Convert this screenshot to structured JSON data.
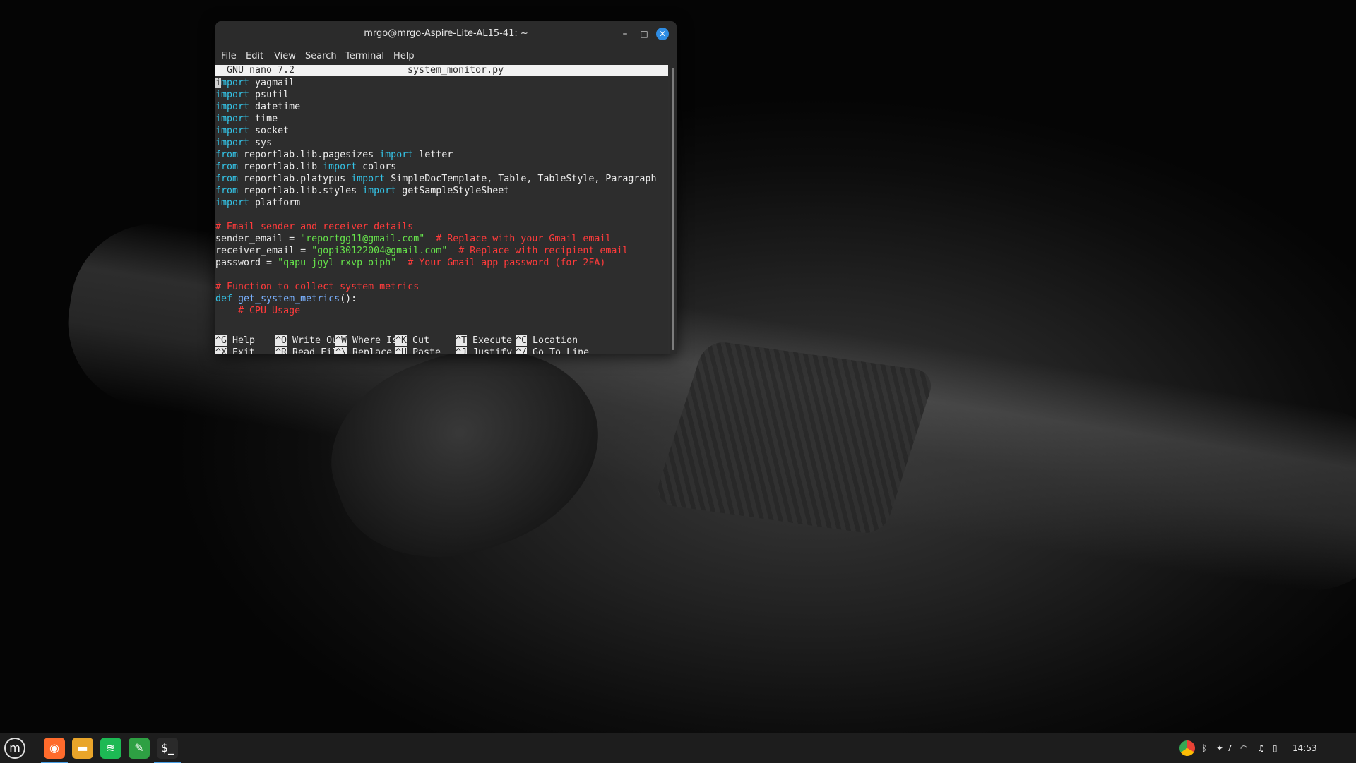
{
  "window": {
    "title": "mrgo@mrgo-Aspire-Lite-AL15-41: ~",
    "controls": {
      "minimize": "–",
      "maximize": "□",
      "close": "✕"
    }
  },
  "menu": [
    "File",
    "Edit",
    "View",
    "Search",
    "Terminal",
    "Help"
  ],
  "nano": {
    "version": "GNU nano 7.2",
    "filename": "system_monitor.py"
  },
  "code_lines": [
    [
      {
        "t": "import",
        "c": "kw"
      },
      {
        "t": " yagmail",
        "c": ""
      }
    ],
    [
      {
        "t": "import",
        "c": "kw"
      },
      {
        "t": " psutil",
        "c": ""
      }
    ],
    [
      {
        "t": "import",
        "c": "kw"
      },
      {
        "t": " datetime",
        "c": ""
      }
    ],
    [
      {
        "t": "import",
        "c": "kw"
      },
      {
        "t": " time",
        "c": ""
      }
    ],
    [
      {
        "t": "import",
        "c": "kw"
      },
      {
        "t": " socket",
        "c": ""
      }
    ],
    [
      {
        "t": "import",
        "c": "kw"
      },
      {
        "t": " sys",
        "c": ""
      }
    ],
    [
      {
        "t": "from",
        "c": "kw"
      },
      {
        "t": " reportlab.lib.pagesizes ",
        "c": ""
      },
      {
        "t": "import",
        "c": "kw"
      },
      {
        "t": " letter",
        "c": ""
      }
    ],
    [
      {
        "t": "from",
        "c": "kw"
      },
      {
        "t": " reportlab.lib ",
        "c": ""
      },
      {
        "t": "import",
        "c": "kw"
      },
      {
        "t": " colors",
        "c": ""
      }
    ],
    [
      {
        "t": "from",
        "c": "kw"
      },
      {
        "t": " reportlab.platypus ",
        "c": ""
      },
      {
        "t": "import",
        "c": "kw"
      },
      {
        "t": " SimpleDocTemplate, Table, TableStyle, Paragraph",
        "c": ""
      }
    ],
    [
      {
        "t": "from",
        "c": "kw"
      },
      {
        "t": " reportlab.lib.styles ",
        "c": ""
      },
      {
        "t": "import",
        "c": "kw"
      },
      {
        "t": " getSampleStyleSheet",
        "c": ""
      }
    ],
    [
      {
        "t": "import",
        "c": "kw"
      },
      {
        "t": " platform",
        "c": ""
      }
    ],
    [],
    [
      {
        "t": "# Email sender and receiver details",
        "c": "cmt"
      }
    ],
    [
      {
        "t": "sender_email = ",
        "c": ""
      },
      {
        "t": "\"reportgg11@gmail.com\"",
        "c": "str"
      },
      {
        "t": "  # Replace with your Gmail email",
        "c": "cmt"
      }
    ],
    [
      {
        "t": "receiver_email = ",
        "c": ""
      },
      {
        "t": "\"gopi30122004@gmail.com\"",
        "c": "str"
      },
      {
        "t": "  # Replace with recipient email",
        "c": "cmt"
      }
    ],
    [
      {
        "t": "password = ",
        "c": ""
      },
      {
        "t": "\"qapu jgyl rxvp oiph\"",
        "c": "str"
      },
      {
        "t": "  # Your Gmail app password (for 2FA)",
        "c": "cmt"
      }
    ],
    [],
    [
      {
        "t": "# Function to collect system metrics",
        "c": "cmt"
      }
    ],
    [
      {
        "t": "def",
        "c": "kw"
      },
      {
        "t": " ",
        "c": ""
      },
      {
        "t": "get_system_metrics",
        "c": "fn"
      },
      {
        "t": "():",
        "c": ""
      }
    ],
    [
      {
        "t": "    # CPU Usage",
        "c": "cmt"
      }
    ]
  ],
  "shortcuts": [
    [
      {
        "key": "^G",
        "label": "Help"
      },
      {
        "key": "^O",
        "label": "Write Out"
      },
      {
        "key": "^W",
        "label": "Where Is"
      },
      {
        "key": "^K",
        "label": "Cut"
      },
      {
        "key": "^T",
        "label": "Execute"
      },
      {
        "key": "^C",
        "label": "Location"
      }
    ],
    [
      {
        "key": "^X",
        "label": "Exit"
      },
      {
        "key": "^R",
        "label": "Read File"
      },
      {
        "key": "^\\",
        "label": "Replace"
      },
      {
        "key": "^U",
        "label": "Paste"
      },
      {
        "key": "^J",
        "label": "Justify"
      },
      {
        "key": "^/",
        "label": "Go To Line"
      }
    ]
  ],
  "taskbar": {
    "apps": [
      {
        "name": "linux-mint-menu-icon",
        "glyph": "m"
      },
      {
        "name": "firefox-icon",
        "glyph": "◉"
      },
      {
        "name": "files-folder-icon",
        "glyph": "▬"
      },
      {
        "name": "spotify-icon",
        "glyph": "≋"
      },
      {
        "name": "xed-text-editor-icon",
        "glyph": "✎"
      },
      {
        "name": "terminal-icon",
        "glyph": "$_"
      }
    ],
    "tray": {
      "notification_count": "7",
      "clock": "14:53"
    }
  },
  "colors": {
    "keyword": "#34c3e6",
    "string": "#66e34b",
    "comment": "#ff3b3b",
    "function": "#7ab1ff",
    "close_button": "#2f8de4"
  }
}
